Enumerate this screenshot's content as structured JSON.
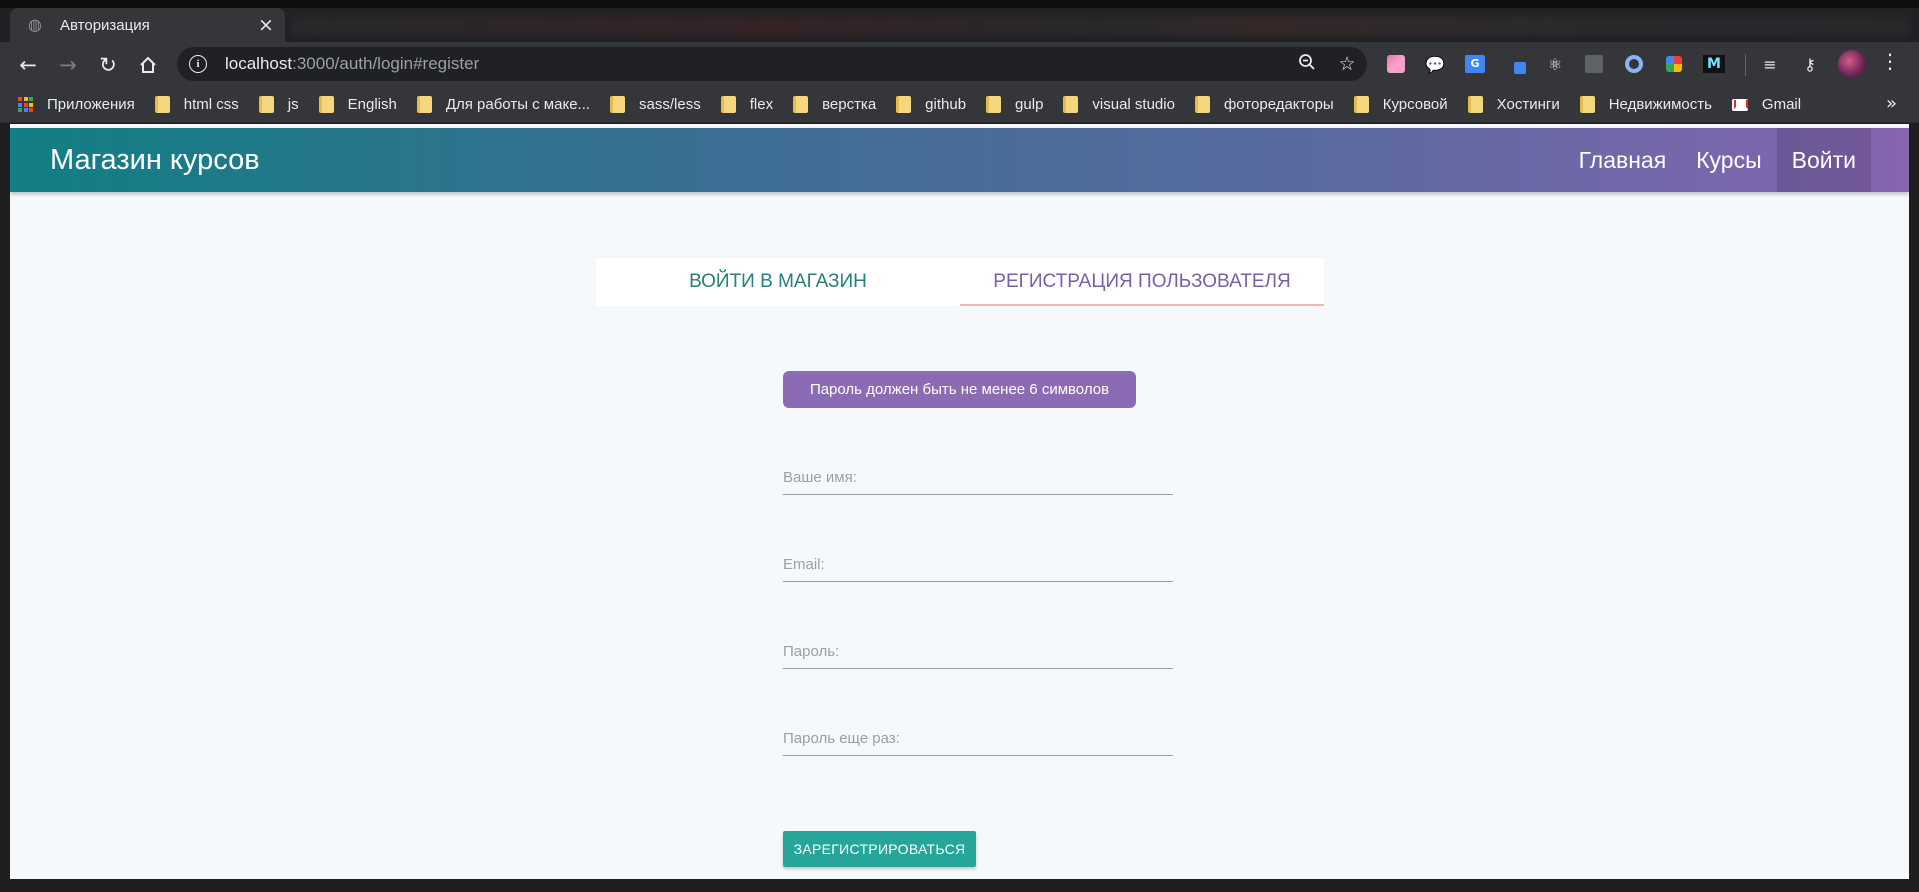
{
  "browser": {
    "tab": {
      "title": "Авторизация",
      "close": "×"
    },
    "url": {
      "host": "localhost",
      "rest": ":3000/auth/login#register"
    },
    "bookmarks": [
      {
        "label": "Приложения",
        "icon": "apps-icon"
      },
      {
        "label": "html css",
        "icon": "folder-icon"
      },
      {
        "label": "js",
        "icon": "folder-icon"
      },
      {
        "label": "English",
        "icon": "folder-icon"
      },
      {
        "label": "Для работы с маке...",
        "icon": "folder-icon"
      },
      {
        "label": "sass/less",
        "icon": "folder-icon"
      },
      {
        "label": "flex",
        "icon": "folder-icon"
      },
      {
        "label": "верстка",
        "icon": "folder-icon"
      },
      {
        "label": "github",
        "icon": "folder-icon"
      },
      {
        "label": "gulp",
        "icon": "folder-icon"
      },
      {
        "label": "visual studio",
        "icon": "folder-icon"
      },
      {
        "label": "фоторедакторы",
        "icon": "folder-icon"
      },
      {
        "label": "Курсовой",
        "icon": "folder-icon"
      },
      {
        "label": "Хостинги",
        "icon": "folder-icon"
      },
      {
        "label": "Недвижимость",
        "icon": "folder-icon"
      },
      {
        "label": "Gmail",
        "icon": "gmail-icon"
      }
    ],
    "more": "»"
  },
  "app": {
    "brand": "Магазин курсов",
    "nav": {
      "home": "Главная",
      "courses": "Курсы",
      "login": "Войти"
    },
    "tabs": {
      "login": "ВОЙТИ В МАГАЗИН",
      "register": "РЕГИСТРАЦИЯ ПОЛЬЗОВАТЕЛЯ"
    },
    "toast": "Пароль должен быть не менее 6 символов",
    "form": {
      "name_placeholder": "Ваше имя:",
      "email_placeholder": "Email:",
      "password_placeholder": "Пароль:",
      "confirm_placeholder": "Пароль еще раз:",
      "submit": "ЗАРЕГИСТРИРОВАТЬСЯ"
    }
  },
  "colors": {
    "header_start": "#117f84",
    "header_end": "#8665b1",
    "toast": "#8c6bb5",
    "button": "#26a69a"
  }
}
